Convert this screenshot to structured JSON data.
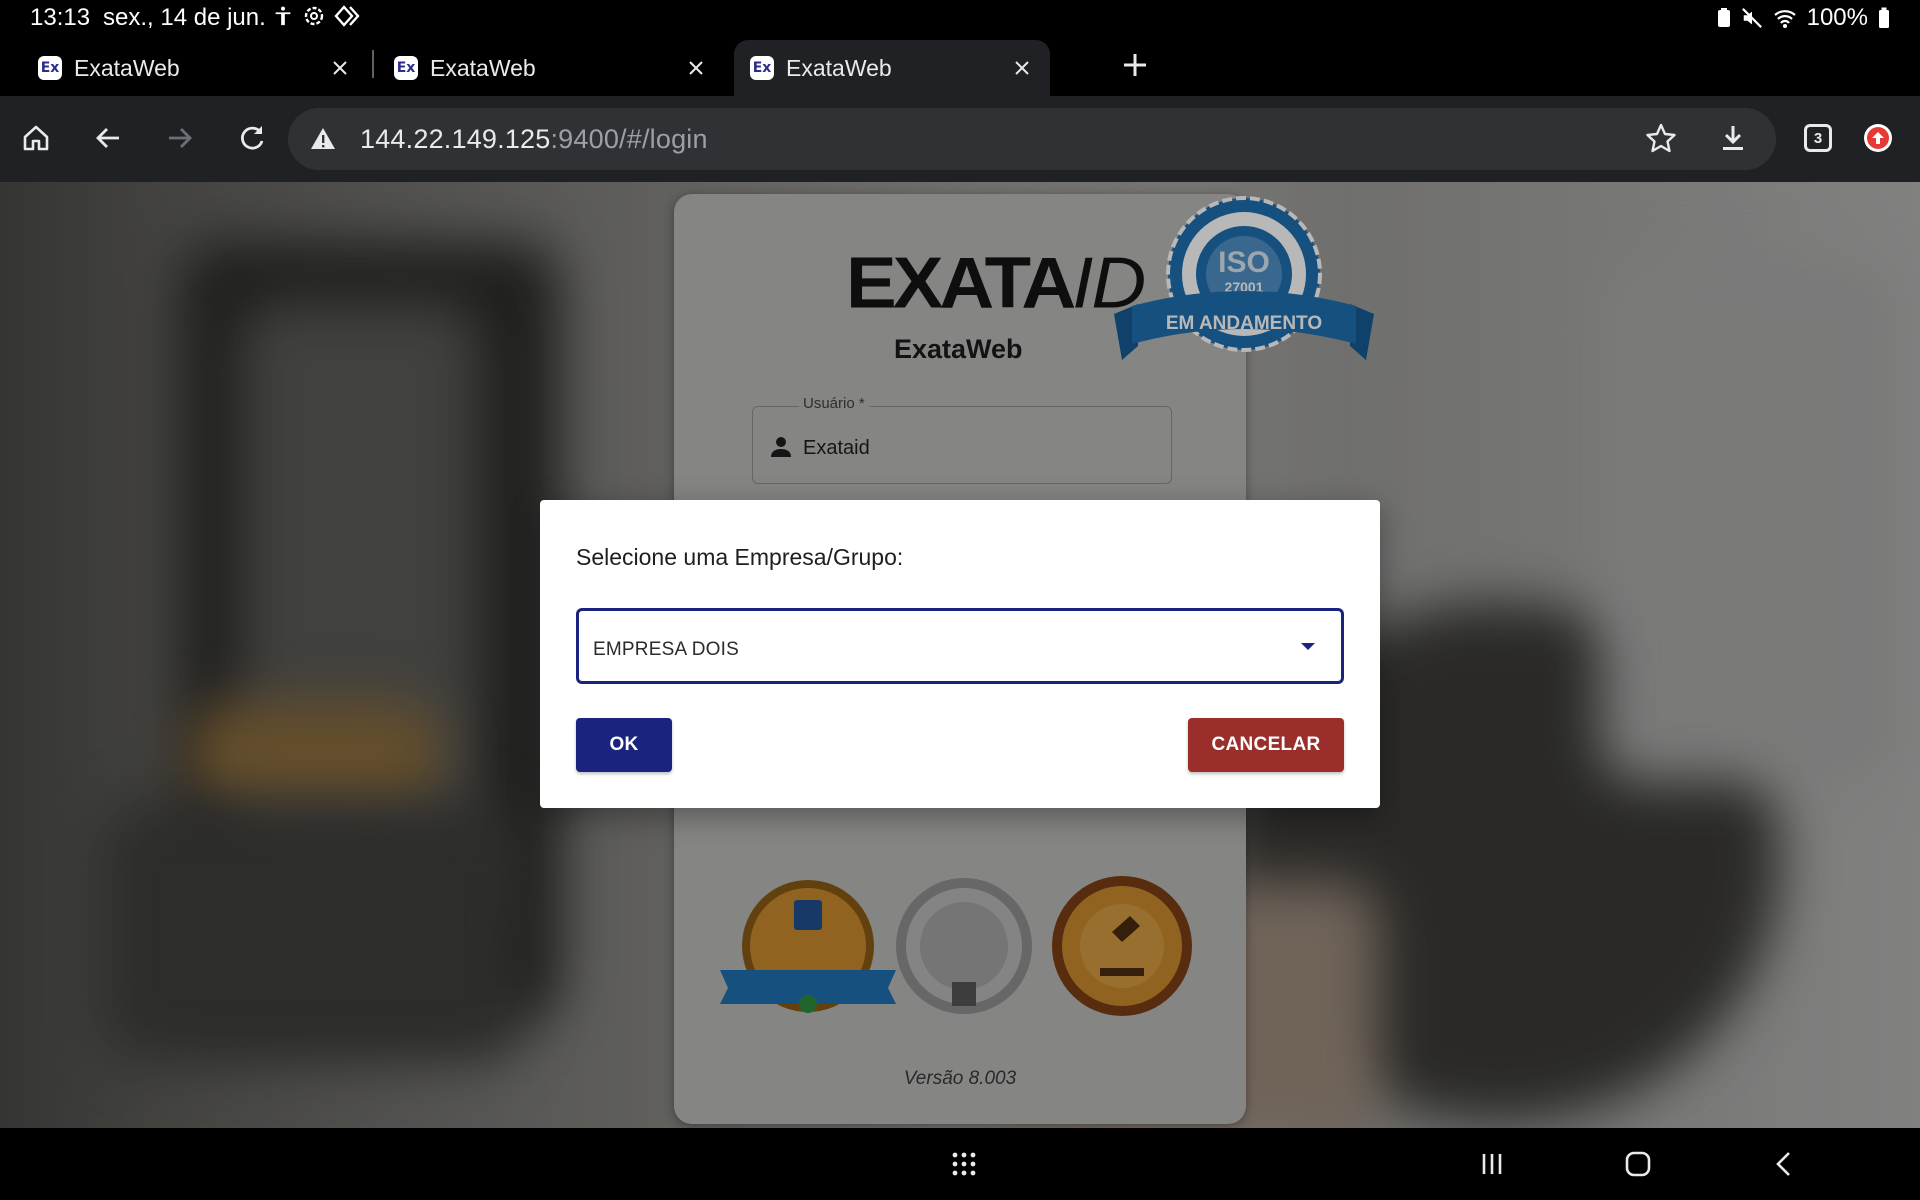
{
  "status_bar": {
    "time": "13:13",
    "date": "sex., 14 de jun.",
    "battery": "100%"
  },
  "tabs": [
    {
      "favicon": "Ex",
      "title": "ExataWeb"
    },
    {
      "favicon": "Ex",
      "title": "ExataWeb"
    },
    {
      "favicon": "Ex",
      "title": "ExataWeb"
    }
  ],
  "active_tab_index": 2,
  "toolbar": {
    "url_host": "144.22.149.125",
    "url_path": ":9400/#/login",
    "tab_count": "3"
  },
  "login": {
    "logo_main": "EXATA",
    "logo_suffix": "ID",
    "app_name": "ExataWeb",
    "username_label": "Usuário *",
    "username_value": "Exataid",
    "version": "Versão 8.003",
    "iso_badge_text": "EM ANDAMENTO",
    "iso_badge_number": "27001"
  },
  "dialog": {
    "title": "Selecione uma Empresa/Grupo:",
    "selected_company": "EMPRESA DOIS",
    "ok_label": "OK",
    "cancel_label": "CANCELAR"
  },
  "colors": {
    "primary": "#1a237e",
    "danger": "#9a2e2b",
    "toolbar_bg": "#202124"
  }
}
